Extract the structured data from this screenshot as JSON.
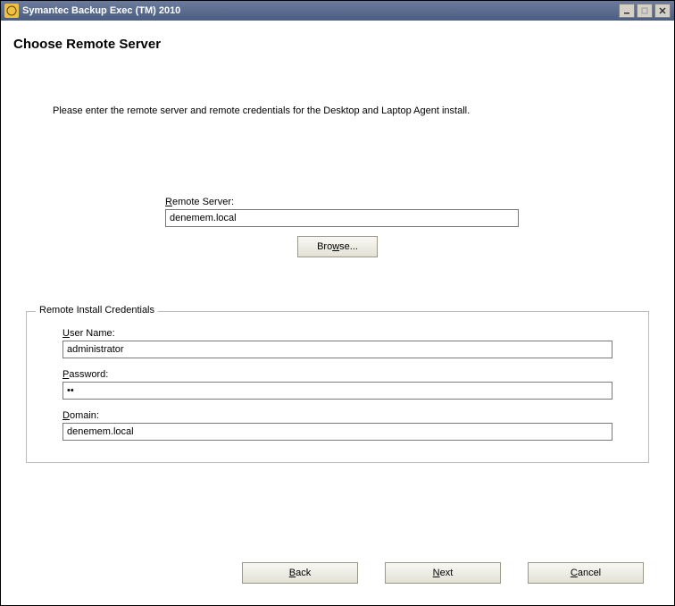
{
  "window": {
    "title": "Symantec Backup Exec (TM) 2010"
  },
  "page": {
    "heading": "Choose Remote Server",
    "instruction": "Please enter the remote server and remote credentials for the Desktop and Laptop Agent install."
  },
  "remote_server": {
    "label": "Remote Server:",
    "value": "denemem.local",
    "browse_label": "Browse..."
  },
  "credentials": {
    "legend": "Remote Install Credentials",
    "username_label": "User Name:",
    "username_value": "administrator",
    "password_label": "Password:",
    "password_value": "••",
    "domain_label": "Domain:",
    "domain_value": "denemem.local"
  },
  "buttons": {
    "back": "Back",
    "next": "Next",
    "cancel": "Cancel"
  }
}
